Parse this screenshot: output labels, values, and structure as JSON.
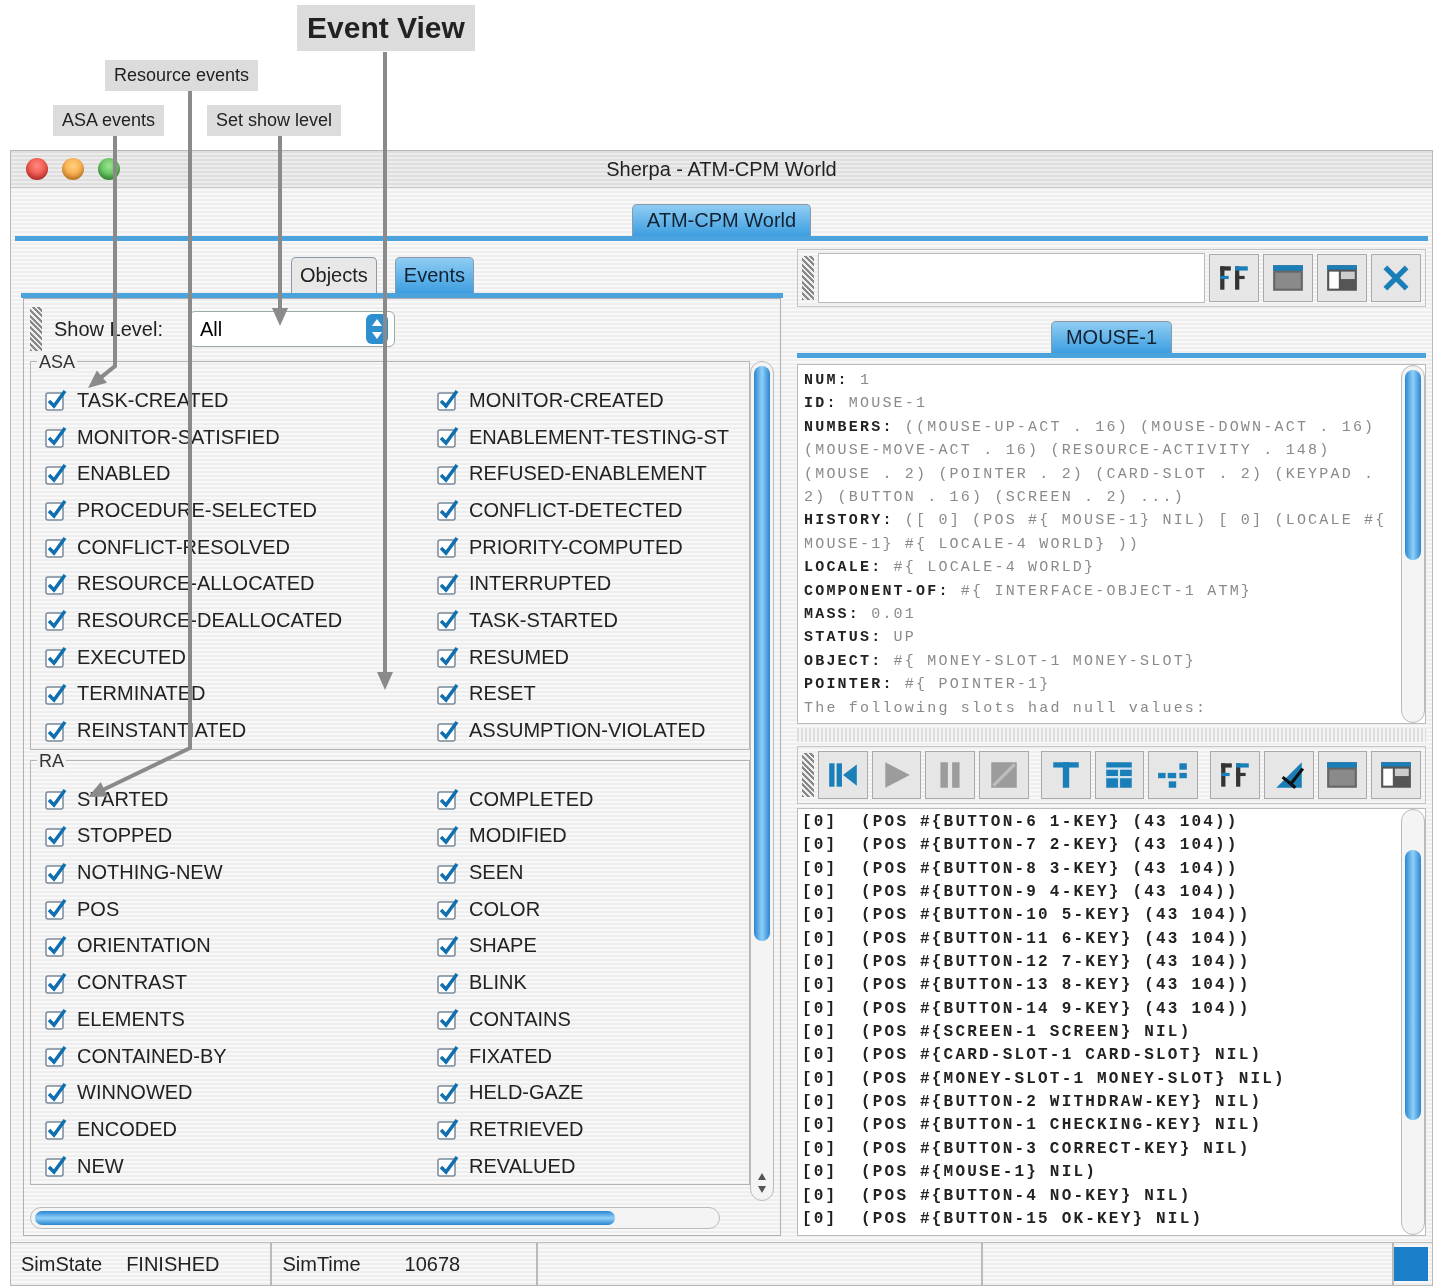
{
  "annotations": [
    {
      "text": "Event View",
      "kind": "title"
    },
    {
      "text": "Resource events",
      "kind": "label"
    },
    {
      "text": "ASA events",
      "kind": "label"
    },
    {
      "text": "Set show level",
      "kind": "label"
    }
  ],
  "window": {
    "title": "Sherpa - ATM-CPM World"
  },
  "world_tabs": [
    {
      "label": "ATM-CPM World",
      "selected": true
    }
  ],
  "left_panel": {
    "tabs": [
      {
        "label": "Objects",
        "selected": false
      },
      {
        "label": "Events",
        "selected": true
      }
    ],
    "show_level": {
      "label": "Show Level:",
      "value": "All"
    },
    "groups": [
      {
        "title": "ASA",
        "items": [
          {
            "label": "TASK-CREATED",
            "checked": true
          },
          {
            "label": "MONITOR-CREATED",
            "checked": true
          },
          {
            "label": "MONITOR-SATISFIED",
            "checked": true
          },
          {
            "label": "ENABLEMENT-TESTING-ST",
            "checked": true
          },
          {
            "label": "ENABLED",
            "checked": true
          },
          {
            "label": "REFUSED-ENABLEMENT",
            "checked": true
          },
          {
            "label": "PROCEDURE-SELECTED",
            "checked": true
          },
          {
            "label": "CONFLICT-DETECTED",
            "checked": true
          },
          {
            "label": "CONFLICT-RESOLVED",
            "checked": true
          },
          {
            "label": "PRIORITY-COMPUTED",
            "checked": true
          },
          {
            "label": "RESOURCE-ALLOCATED",
            "checked": true
          },
          {
            "label": "INTERRUPTED",
            "checked": true
          },
          {
            "label": "RESOURCE-DEALLOCATED",
            "checked": true
          },
          {
            "label": "TASK-STARTED",
            "checked": true
          },
          {
            "label": "EXECUTED",
            "checked": true
          },
          {
            "label": "RESUMED",
            "checked": true
          },
          {
            "label": "TERMINATED",
            "checked": true
          },
          {
            "label": "RESET",
            "checked": true
          },
          {
            "label": "REINSTANTIATED",
            "checked": true
          },
          {
            "label": "ASSUMPTION-VIOLATED",
            "checked": true
          }
        ]
      },
      {
        "title": "RA",
        "items": [
          {
            "label": "STARTED",
            "checked": true
          },
          {
            "label": "COMPLETED",
            "checked": true
          },
          {
            "label": "STOPPED",
            "checked": true
          },
          {
            "label": "MODIFIED",
            "checked": true
          },
          {
            "label": "NOTHING-NEW",
            "checked": true
          },
          {
            "label": "SEEN",
            "checked": true
          },
          {
            "label": "POS",
            "checked": true
          },
          {
            "label": "COLOR",
            "checked": true
          },
          {
            "label": "ORIENTATION",
            "checked": true
          },
          {
            "label": "SHAPE",
            "checked": true
          },
          {
            "label": "CONTRAST",
            "checked": true
          },
          {
            "label": "BLINK",
            "checked": true
          },
          {
            "label": "ELEMENTS",
            "checked": true
          },
          {
            "label": "CONTAINS",
            "checked": true
          },
          {
            "label": "CONTAINED-BY",
            "checked": true
          },
          {
            "label": "FIXATED",
            "checked": true
          },
          {
            "label": "WINNOWED",
            "checked": true
          },
          {
            "label": "HELD-GAZE",
            "checked": true
          },
          {
            "label": "ENCODED",
            "checked": true
          },
          {
            "label": "RETRIEVED",
            "checked": true
          },
          {
            "label": "NEW",
            "checked": true
          },
          {
            "label": "REVALUED",
            "checked": true
          }
        ]
      }
    ]
  },
  "right_panel": {
    "top_toolbar": [
      {
        "kind": "font",
        "disabled": false
      },
      {
        "kind": "window",
        "disabled": false
      },
      {
        "kind": "split",
        "disabled": false
      },
      {
        "kind": "close",
        "disabled": false
      }
    ],
    "object_tabs": [
      {
        "label": "MOUSE-1",
        "selected": true
      }
    ],
    "slots": [
      "**NUM:** 1",
      "**ID:** MOUSE-1",
      "**NUMBERS:** ((MOUSE-UP-ACT . 16) (MOUSE-DOWN-ACT . 16) (MOUSE-MOVE-ACT . 16) (RESOURCE-ACTIVITY . 148) (MOUSE . 2) (POINTER . 2) (CARD-SLOT . 2) (KEYPAD . 2) (BUTTON . 16) (SCREEN . 2) ...)",
      "**HISTORY:** ([ 0] (POS #{ MOUSE-1} NIL) [ 0] (LOCALE #{ MOUSE-1} #{ LOCALE-4 WORLD} ))",
      "**LOCALE:** #{ LOCALE-4 WORLD}",
      "**COMPONENT-OF:** #{ INTERFACE-OBJECT-1 ATM}",
      "**MASS:** 0.01",
      "**STATUS:** UP",
      "**OBJECT:** #{ MONEY-SLOT-1 MONEY-SLOT}",
      "**POINTER:** #{ POINTER-1}",
      "The following slots had null values:"
    ],
    "event_toolbar": [
      {
        "kind": "step-back",
        "disabled": false
      },
      {
        "kind": "play",
        "disabled": true
      },
      {
        "kind": "pause",
        "disabled": true
      },
      {
        "kind": "stop",
        "disabled": true
      },
      {
        "kind": "text",
        "disabled": false
      },
      {
        "kind": "table",
        "disabled": false
      },
      {
        "kind": "graph",
        "disabled": false
      },
      {
        "kind": "font",
        "disabled": false
      },
      {
        "kind": "edit",
        "disabled": false
      },
      {
        "kind": "window",
        "disabled": false
      },
      {
        "kind": "split",
        "disabled": false
      }
    ],
    "events": [
      "[0]  (POS #{BUTTON-6 1-KEY} (43 104))",
      "[0]  (POS #{BUTTON-7 2-KEY} (43 104))",
      "[0]  (POS #{BUTTON-8 3-KEY} (43 104))",
      "[0]  (POS #{BUTTON-9 4-KEY} (43 104))",
      "[0]  (POS #{BUTTON-10 5-KEY} (43 104))",
      "[0]  (POS #{BUTTON-11 6-KEY} (43 104))",
      "[0]  (POS #{BUTTON-12 7-KEY} (43 104))",
      "[0]  (POS #{BUTTON-13 8-KEY} (43 104))",
      "[0]  (POS #{BUTTON-14 9-KEY} (43 104))",
      "[0]  (POS #{SCREEN-1 SCREEN} NIL)",
      "[0]  (POS #{CARD-SLOT-1 CARD-SLOT} NIL)",
      "[0]  (POS #{MONEY-SLOT-1 MONEY-SLOT} NIL)",
      "[0]  (POS #{BUTTON-2 WITHDRAW-KEY} NIL)",
      "[0]  (POS #{BUTTON-1 CHECKING-KEY} NIL)",
      "[0]  (POS #{BUTTON-3 CORRECT-KEY} NIL)",
      "[0]  (POS #{MOUSE-1} NIL)",
      "[0]  (POS #{BUTTON-4 NO-KEY} NIL)",
      "[0]  (POS #{BUTTON-15 OK-KEY} NIL)"
    ]
  },
  "status_bar": [
    {
      "label": "SimState",
      "value": "FINISHED"
    },
    {
      "label": "SimTime",
      "value": "10678"
    }
  ]
}
